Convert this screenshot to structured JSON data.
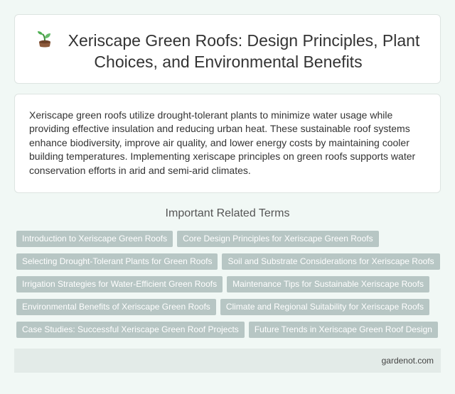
{
  "header": {
    "title": "Xeriscape Green Roofs: Design Principles, Plant Choices, and Environmental Benefits",
    "icon": "sprout-icon"
  },
  "description": {
    "text": "Xeriscape green roofs utilize drought-tolerant plants to minimize water usage while providing effective insulation and reducing urban heat. These sustainable roof systems enhance biodiversity, improve air quality, and lower energy costs by maintaining cooler building temperatures. Implementing xeriscape principles on green roofs supports water conservation efforts in arid and semi-arid climates."
  },
  "related": {
    "title": "Important Related Terms",
    "tags": [
      "Introduction to Xeriscape Green Roofs",
      "Core Design Principles for Xeriscape Green Roofs",
      "Selecting Drought-Tolerant Plants for Green Roofs",
      "Soil and Substrate Considerations for Xeriscape Roofs",
      "Irrigation Strategies for Water-Efficient Green Roofs",
      "Maintenance Tips for Sustainable Xeriscape Roofs",
      "Environmental Benefits of Xeriscape Green Roofs",
      "Climate and Regional Suitability for Xeriscape Roofs",
      "Case Studies: Successful Xeriscape Green Roof Projects",
      "Future Trends in Xeriscape Green Roof Design"
    ]
  },
  "footer": {
    "site": "gardenot.com"
  },
  "colors": {
    "background": "#f1f8f5",
    "tag_background": "#b7c6c4",
    "footer_background": "#e3ebe8"
  }
}
